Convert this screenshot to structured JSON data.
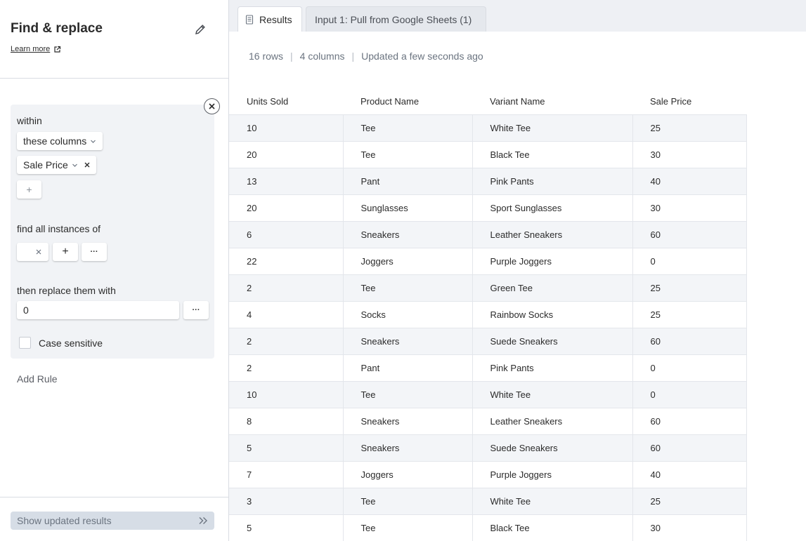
{
  "sidebar": {
    "title": "Find & replace",
    "learn_more": "Learn more",
    "rule": {
      "within_label": "within",
      "scope_select": "these columns",
      "column_chip": "Sale Price",
      "add_column": "+",
      "find_label": "find all instances of",
      "find_value": "",
      "find_add": "+",
      "find_more": "···",
      "replace_label": "then replace them with",
      "replace_value": "0",
      "replace_more": "···",
      "case_sensitive_label": "Case sensitive",
      "case_sensitive_checked": false
    },
    "add_rule": "Add Rule",
    "show_results": "Show updated results"
  },
  "tabs": [
    {
      "label": "Results",
      "active": true
    },
    {
      "label": "Input 1: Pull from Google Sheets (1)",
      "active": false
    }
  ],
  "meta": {
    "rows": "16 rows",
    "columns": "4 columns",
    "updated": "Updated a few seconds ago"
  },
  "table": {
    "headers": [
      "Units Sold",
      "Product Name",
      "Variant Name",
      "Sale Price"
    ],
    "rows": [
      [
        "10",
        "Tee",
        "White Tee",
        "25"
      ],
      [
        "20",
        "Tee",
        "Black Tee",
        "30"
      ],
      [
        "13",
        "Pant",
        "Pink Pants",
        "40"
      ],
      [
        "20",
        "Sunglasses",
        "Sport Sunglasses",
        "30"
      ],
      [
        "6",
        "Sneakers",
        "Leather Sneakers",
        "60"
      ],
      [
        "22",
        "Joggers",
        "Purple Joggers",
        "0"
      ],
      [
        "2",
        "Tee",
        "Green Tee",
        "25"
      ],
      [
        "4",
        "Socks",
        "Rainbow Socks",
        "25"
      ],
      [
        "2",
        "Sneakers",
        "Suede Sneakers",
        "60"
      ],
      [
        "2",
        "Pant",
        "Pink Pants",
        "0"
      ],
      [
        "10",
        "Tee",
        "White Tee",
        "0"
      ],
      [
        "8",
        "Sneakers",
        "Leather Sneakers",
        "60"
      ],
      [
        "5",
        "Sneakers",
        "Suede Sneakers",
        "60"
      ],
      [
        "7",
        "Joggers",
        "Purple Joggers",
        "40"
      ],
      [
        "3",
        "Tee",
        "White Tee",
        "25"
      ],
      [
        "5",
        "Tee",
        "Black Tee",
        "30"
      ]
    ]
  },
  "colors": {
    "row_stripe": "#f3f5f8",
    "button_bg": "#d6dde6",
    "rule_card_bg": "#f1f3f6"
  },
  "icons": {
    "edit": "pencil-icon",
    "learn_more": "external-link-icon",
    "close_rule": "close-icon",
    "results_tab": "document-icon",
    "show_results": "double-chevron-right-icon"
  }
}
